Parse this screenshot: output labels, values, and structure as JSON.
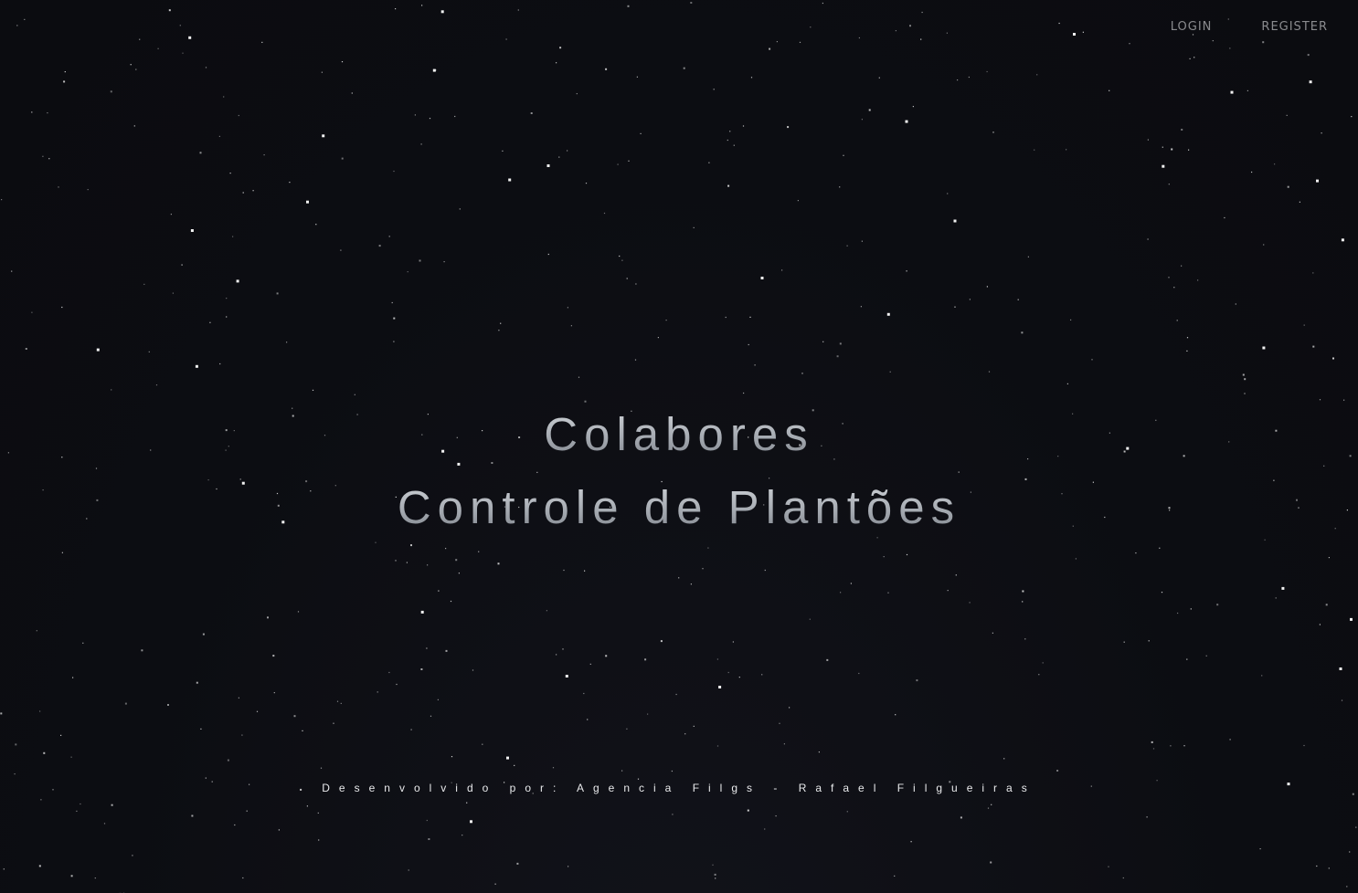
{
  "nav": {
    "login_label": "LOGIN",
    "register_label": "REGISTER"
  },
  "hero": {
    "title": "Colabores",
    "subtitle": "Controle de Plantões"
  },
  "footer": {
    "credit": "Desenvolvido por: Agencia Filgs - Rafael Filgueiras"
  },
  "colors": {
    "background": "#0c0d12",
    "nav_text": "#8a8b8e",
    "hero_text": "#a9aeb5",
    "footer_text": "#e9eaec",
    "stars": "#ffffff"
  }
}
